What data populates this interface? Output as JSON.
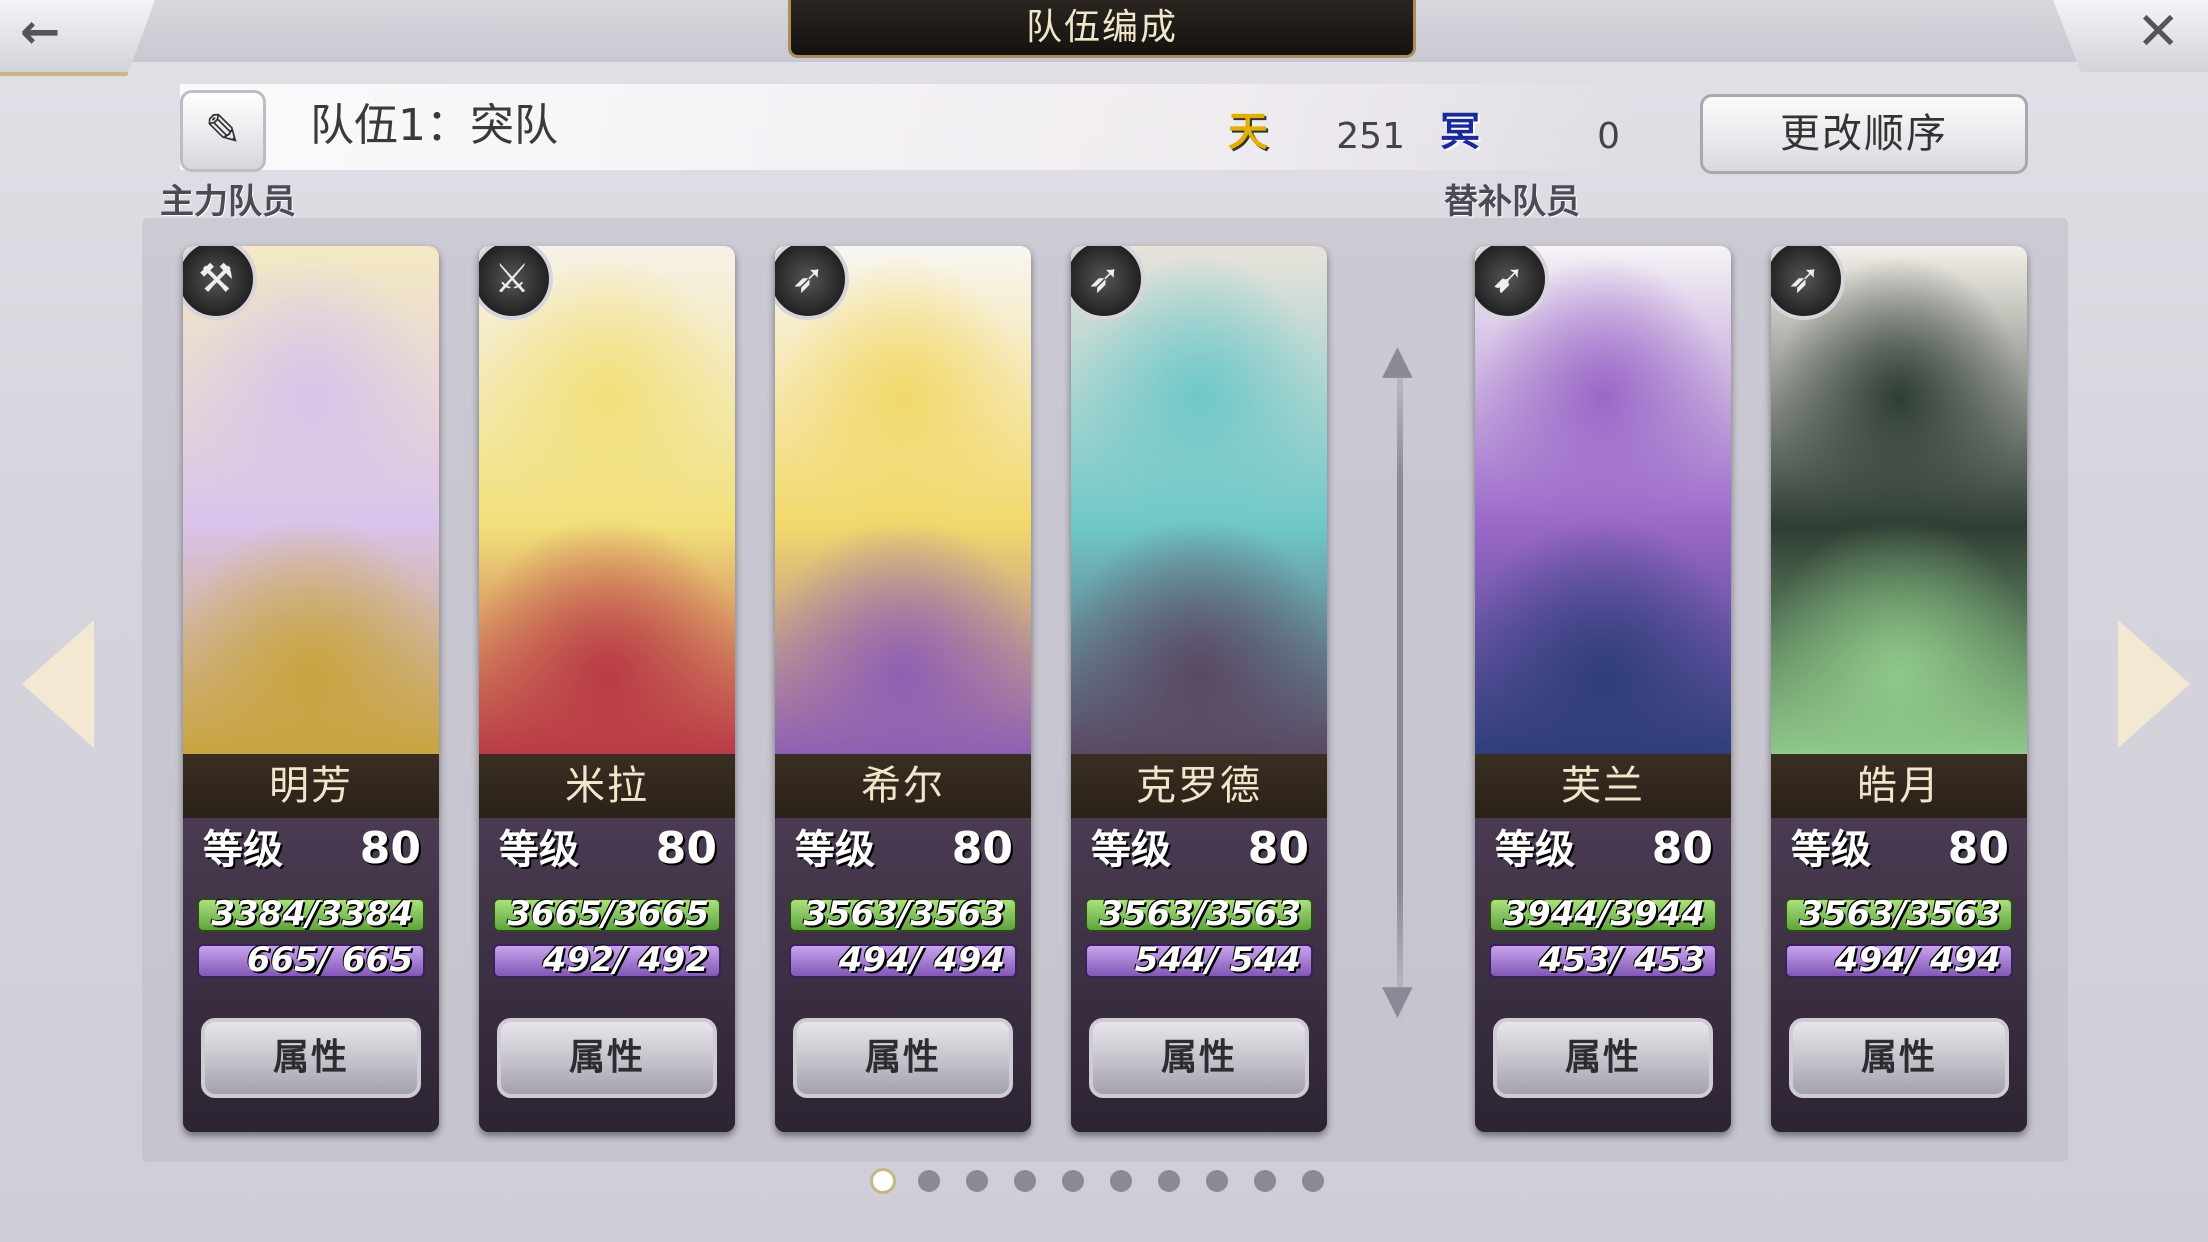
{
  "header": {
    "title": "队伍编成",
    "back_glyph": "←",
    "close_glyph": "✕"
  },
  "team": {
    "name": "队伍1：突队",
    "edit_glyph": "✎",
    "sky_icon": "天",
    "sky_value": "251",
    "dark_icon": "冥",
    "dark_value": "0",
    "reorder_label": "更改顺序"
  },
  "sections": {
    "main": "主力队员",
    "sub": "替补队员"
  },
  "cards": [
    {
      "name": "明芳",
      "level_label": "等级",
      "level": "80",
      "hp": "3384/3384",
      "mp": "665/ 665",
      "attr_label": "属性",
      "weapon_icon": "hammer-icon",
      "weapon_glyph": "⚒",
      "colors": [
        "#d9c3ea",
        "#f4e9c4",
        "#c8a43f"
      ]
    },
    {
      "name": "米拉",
      "level_label": "等级",
      "level": "80",
      "hp": "3665/3665",
      "mp": "492/ 492",
      "attr_label": "属性",
      "weapon_icon": "sword-icon",
      "weapon_glyph": "⚔",
      "colors": [
        "#f1e07a",
        "#f6f1e8",
        "#b93a46"
      ]
    },
    {
      "name": "希尔",
      "level_label": "等级",
      "level": "80",
      "hp": "3563/3563",
      "mp": "494/ 494",
      "attr_label": "属性",
      "weapon_icon": "bow-icon",
      "weapon_glyph": "➶",
      "colors": [
        "#f2d86a",
        "#f8f6f2",
        "#8f5fb3"
      ]
    },
    {
      "name": "克罗德",
      "level_label": "等级",
      "level": "80",
      "hp": "3563/3563",
      "mp": "544/ 544",
      "attr_label": "属性",
      "weapon_icon": "bow-icon",
      "weapon_glyph": "➶",
      "colors": [
        "#6fc8c8",
        "#e8e2da",
        "#5a4862"
      ]
    },
    {
      "name": "芙兰",
      "level_label": "等级",
      "level": "80",
      "hp": "3944/3944",
      "mp": "453/ 453",
      "attr_label": "属性",
      "weapon_icon": "spear-icon",
      "weapon_glyph": "➹",
      "colors": [
        "#9a68c8",
        "#f6f3f6",
        "#2f3e7a"
      ]
    },
    {
      "name": "皓月",
      "level_label": "等级",
      "level": "80",
      "hp": "3563/3563",
      "mp": "494/ 494",
      "attr_label": "属性",
      "weapon_icon": "bow-icon",
      "weapon_glyph": "➶",
      "colors": [
        "#2f3d34",
        "#f3efe9",
        "#8fc98a"
      ]
    }
  ],
  "pagination": {
    "count": 10,
    "active": 0
  },
  "colors": {
    "accent_gold": "#c8b685",
    "hp_green": "#5fa43d",
    "mp_purple": "#8158b5"
  }
}
